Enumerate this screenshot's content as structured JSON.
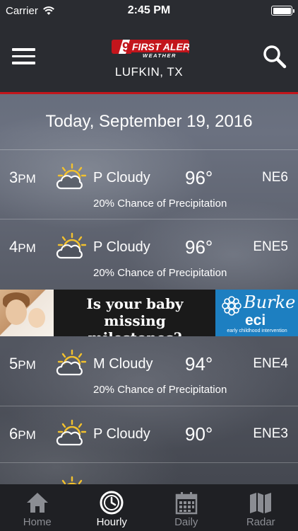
{
  "status_bar": {
    "carrier": "Carrier",
    "time": "2:45 PM",
    "wifi_icon": "wifi-icon",
    "battery_icon": "battery-icon"
  },
  "header": {
    "logo_number": "9",
    "logo_line1": "FIRST ALERT",
    "logo_line2": "WEATHER",
    "city": "LUFKIN, TX",
    "menu_icon": "hamburger-menu-icon",
    "search_icon": "search-icon",
    "accent_color": "#c3151c"
  },
  "date_label": "Today, September 19, 2016",
  "hours": [
    {
      "hour": "3",
      "ampm": "PM",
      "icon": "partly-cloudy-icon",
      "condition": "P Cloudy",
      "temp": "96°",
      "wind": "NE6",
      "precip": "20% Chance of Precipitation"
    },
    {
      "hour": "4",
      "ampm": "PM",
      "icon": "partly-cloudy-icon",
      "condition": "P Cloudy",
      "temp": "96°",
      "wind": "ENE5",
      "precip": "20% Chance of Precipitation"
    },
    {
      "hour": "5",
      "ampm": "PM",
      "icon": "partly-cloudy-icon",
      "condition": "M Cloudy",
      "temp": "94°",
      "wind": "ENE4",
      "precip": "20% Chance of Precipitation"
    },
    {
      "hour": "6",
      "ampm": "PM",
      "icon": "partly-cloudy-icon",
      "condition": "P Cloudy",
      "temp": "90°",
      "wind": "ENE3",
      "precip": ""
    }
  ],
  "ad": {
    "line1": "Is your baby",
    "line2": "missing milestones?",
    "brand": "Burke",
    "brand_sub": "eci",
    "brand_tagline": "early childhood intervention",
    "brand_color": "#1d7fc1"
  },
  "tabs": [
    {
      "label": "Home",
      "icon": "home-icon",
      "active": false
    },
    {
      "label": "Hourly",
      "icon": "clock-icon",
      "active": true
    },
    {
      "label": "Daily",
      "icon": "calendar-icon",
      "active": false
    },
    {
      "label": "Radar",
      "icon": "map-icon",
      "active": false
    }
  ]
}
